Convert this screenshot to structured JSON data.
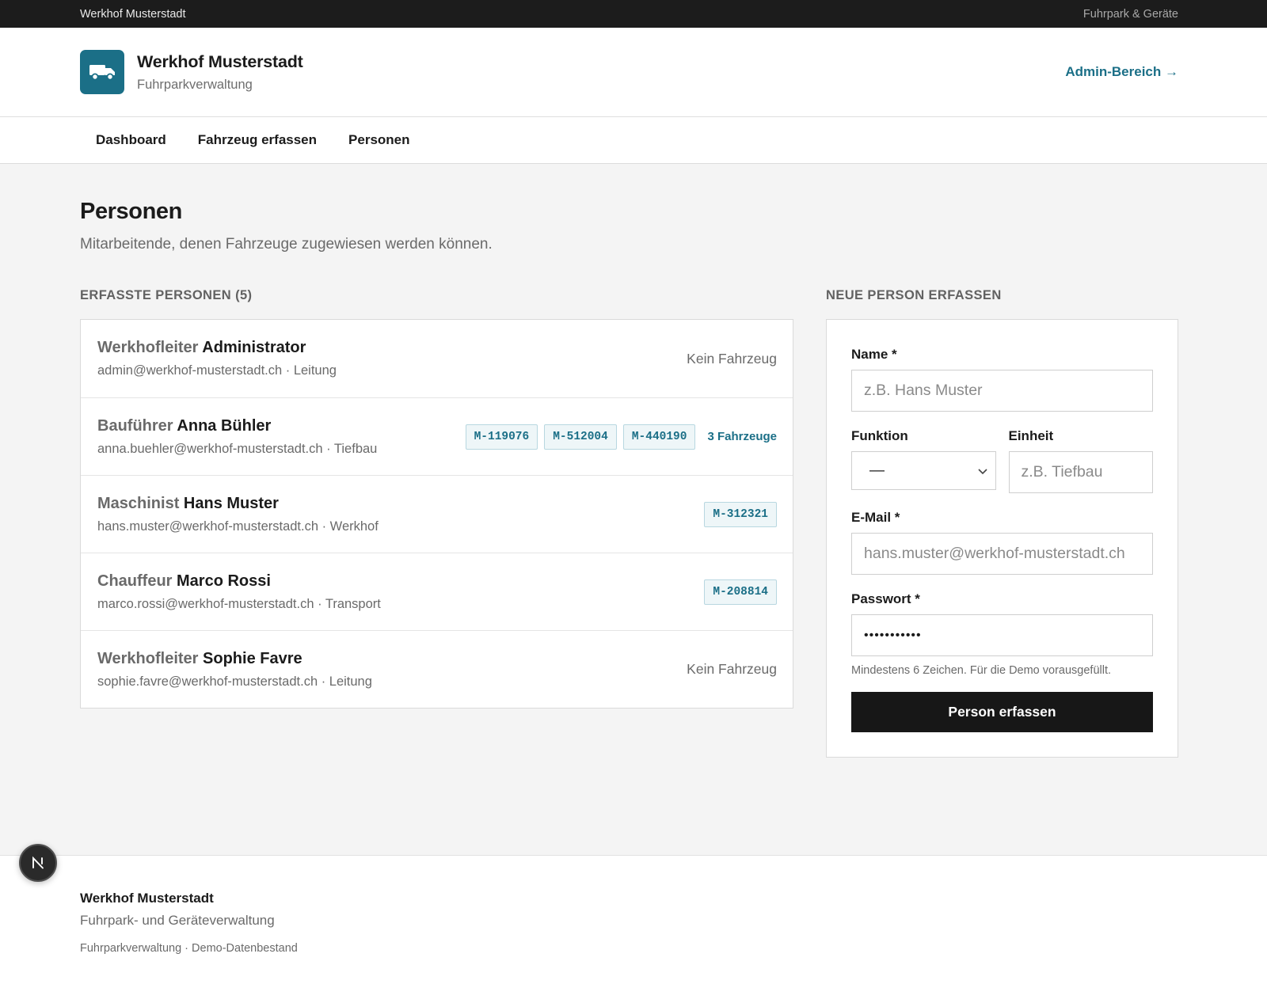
{
  "topbar": {
    "org": "Werkhof Musterstadt",
    "tagline": "Fuhrpark & Geräte"
  },
  "header": {
    "title": "Werkhof Musterstadt",
    "subtitle": "Fuhrparkverwaltung",
    "admin_link": "Admin-Bereich →",
    "logo_icon": "truck-icon"
  },
  "nav": {
    "items": [
      "Dashboard",
      "Fahrzeug erfassen",
      "Personen"
    ]
  },
  "page": {
    "title": "Personen",
    "subtitle": "Mitarbeitende, denen Fahrzeuge zugewiesen werden können."
  },
  "list": {
    "heading": "Erfasste Personen (5)",
    "people": [
      {
        "role": "Werkhofleiter",
        "name": "Administrator",
        "meta": "admin@werkhof-musterstadt.ch · Leitung",
        "no_vehicle": "Kein Fahrzeug"
      },
      {
        "role": "Bauführer",
        "name": "Anna Bühler",
        "meta": "anna.buehler@werkhof-musterstadt.ch · Tiefbau",
        "plates": [
          "M-119076",
          "M-512004",
          "M-440190"
        ],
        "count": "3 Fahrzeuge"
      },
      {
        "role": "Maschinist",
        "name": "Hans Muster",
        "meta": "hans.muster@werkhof-musterstadt.ch · Werkhof",
        "plates": [
          "M-312321"
        ]
      },
      {
        "role": "Chauffeur",
        "name": "Marco Rossi",
        "meta": "marco.rossi@werkhof-musterstadt.ch · Transport",
        "plates": [
          "M-208814"
        ]
      },
      {
        "role": "Werkhofleiter",
        "name": "Sophie Favre",
        "meta": "sophie.favre@werkhof-musterstadt.ch · Leitung",
        "no_vehicle": "Kein Fahrzeug"
      }
    ]
  },
  "form": {
    "heading": "Neue Person erfassen",
    "name_label": "Name *",
    "name_placeholder": "z.B. Hans Muster",
    "funktion_label": "Funktion",
    "funktion_value": "—",
    "einheit_label": "Einheit",
    "einheit_placeholder": "z.B. Tiefbau",
    "email_label": "E-Mail *",
    "email_placeholder": "hans.muster@werkhof-musterstadt.ch",
    "password_label": "Passwort *",
    "password_value": "•••••••••••",
    "hint": "Mindestens 6 Zeichen. Für die Demo vorausgefüllt.",
    "submit": "Person erfassen"
  },
  "footer": {
    "title": "Werkhof Musterstadt",
    "subtitle": "Fuhrpark- und Geräteverwaltung",
    "meta": "Fuhrparkverwaltung · Demo-Datenbestand"
  },
  "colors": {
    "accent": "#1b6f87",
    "dark": "#1c1c1c",
    "background": "#f4f4f4"
  }
}
